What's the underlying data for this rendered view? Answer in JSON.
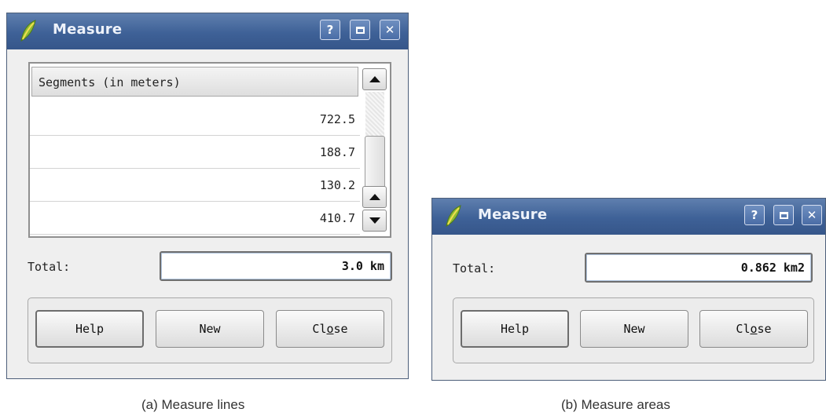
{
  "window_a": {
    "title": "Measure",
    "titlebar_buttons": {
      "help": "?",
      "maximize": "▫",
      "close": "✕"
    },
    "segments_header": "Segments (in meters)",
    "segments": [
      "722.5",
      "188.7",
      "130.2",
      "410.7"
    ],
    "total_label": "Total:",
    "total_value": "3.0 km",
    "buttons": {
      "help": "Help",
      "new": "New",
      "close_pre": "Cl",
      "close_mnemonic": "o",
      "close_post": "se"
    }
  },
  "window_b": {
    "title": "Measure",
    "titlebar_buttons": {
      "help": "?",
      "maximize": "▫",
      "close": "✕"
    },
    "total_label": "Total:",
    "total_value": "0.862 km2",
    "buttons": {
      "help": "Help",
      "new": "New",
      "close_pre": "Cl",
      "close_mnemonic": "o",
      "close_post": "se"
    }
  },
  "captions": {
    "a": "(a) Measure lines",
    "b": "(b) Measure areas"
  },
  "colors": {
    "titlebar": "#3e6197",
    "dialog_bg": "#efefef",
    "field_focus": "#b0c4de"
  },
  "icons": {
    "app": "qgis-leaf-icon"
  }
}
